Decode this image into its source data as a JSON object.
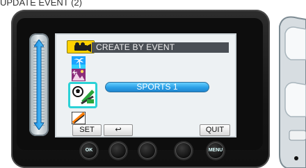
{
  "caption": {
    "text": "UPDATE EVENT (2)"
  },
  "screen": {
    "title": "CREATE BY EVENT",
    "mode_tab_icon": "video-camera-icon",
    "selected_event": "SPORTS 1",
    "events": [
      {
        "icon": "vacation-palm-icon"
      },
      {
        "icon": "landscape-icon"
      },
      {
        "icon": "sports-icon",
        "selected": true
      },
      {
        "icon": "other-icon"
      }
    ]
  },
  "buttons": {
    "set": "SET",
    "back_symbol": "↩",
    "quit": "QUIT"
  },
  "hardware": {
    "ok_label": "OK",
    "menu_label": "MENU"
  },
  "colors": {
    "accent_yellow": "#ffd200",
    "selection_cyan": "#2bd1d6",
    "button_blue": "#2a9fe6",
    "title_bar": "#4a4f55"
  }
}
